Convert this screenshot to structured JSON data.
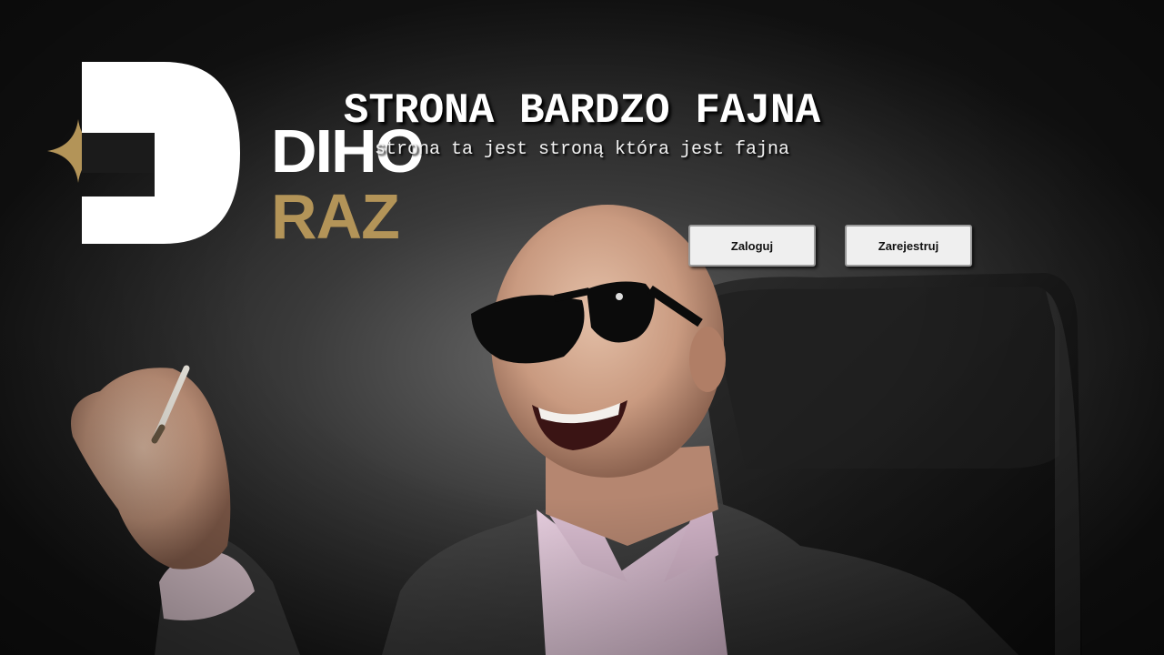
{
  "logo": {
    "name": "DIHO",
    "sub": "RAZ",
    "colors": {
      "white": "#ffffff",
      "gold": "#b39458"
    }
  },
  "header": {
    "title": "STRONA BARDZO FAJNA",
    "subtitle": "strona ta jest stroną która jest fajna"
  },
  "buttons": {
    "login_label": "Zaloguj",
    "register_label": "Zarejestruj"
  },
  "background": {
    "description_icon": "portrait-photo"
  }
}
